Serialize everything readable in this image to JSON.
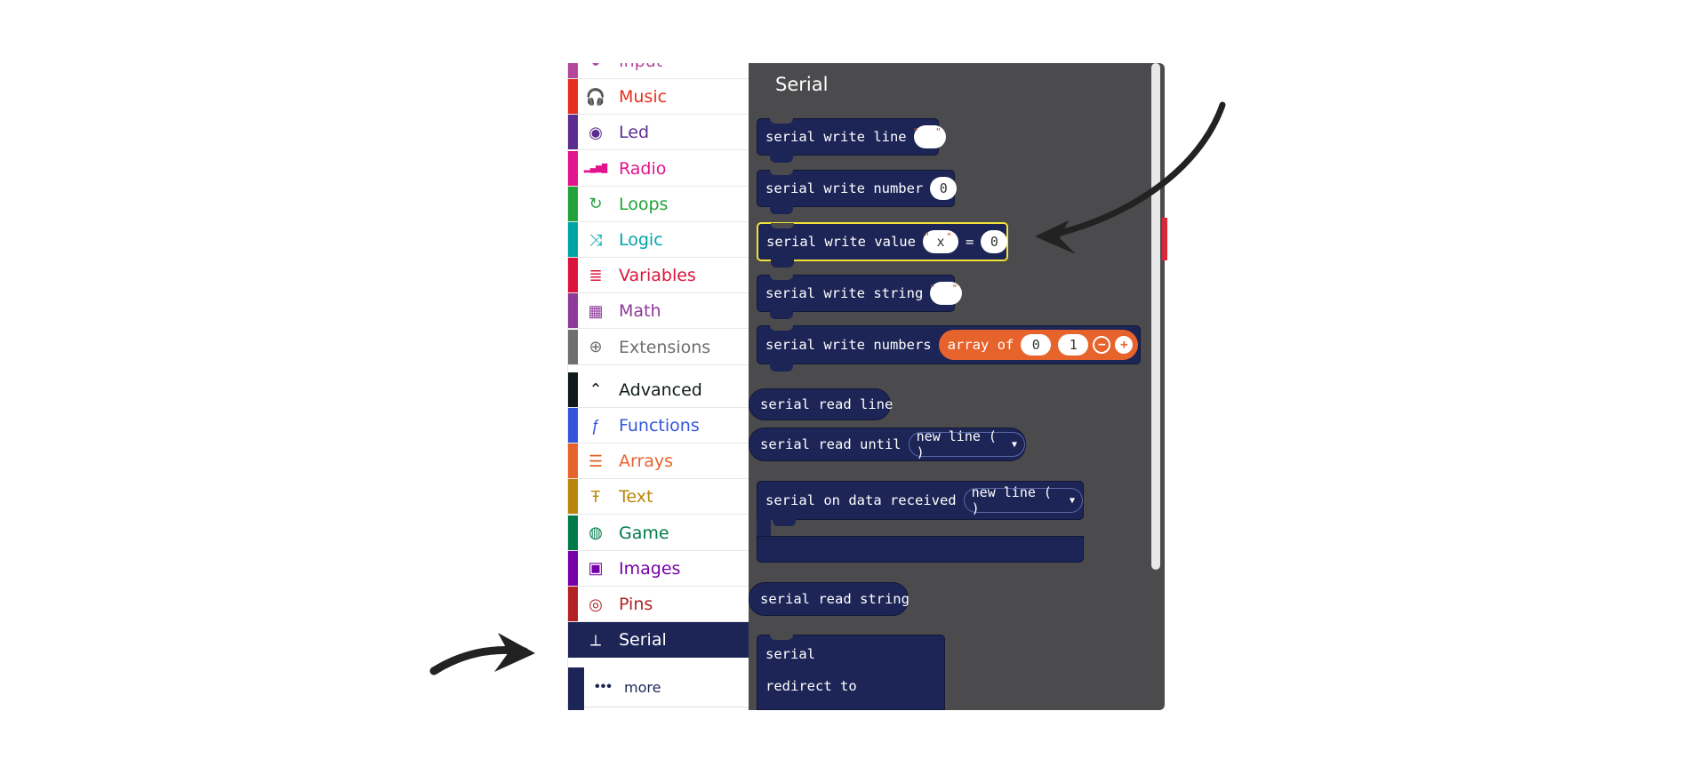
{
  "toolbox": {
    "items": [
      {
        "label": "Input",
        "color": "#b4479c",
        "icon": "input-icon"
      },
      {
        "label": "Music",
        "color": "#e52f1f",
        "icon": "headphones-icon"
      },
      {
        "label": "Led",
        "color": "#5c2d91",
        "icon": "toggle-icon"
      },
      {
        "label": "Radio",
        "color": "#e3138d",
        "icon": "signal-bars-icon"
      },
      {
        "label": "Loops",
        "color": "#21a339",
        "icon": "refresh-icon"
      },
      {
        "label": "Logic",
        "color": "#00a4a6",
        "icon": "shuffle-icon"
      },
      {
        "label": "Variables",
        "color": "#dc143c",
        "icon": "list-lines-icon"
      },
      {
        "label": "Math",
        "color": "#8e3a9a",
        "icon": "calculator-icon"
      },
      {
        "label": "Extensions",
        "color": "#6f6f6f",
        "icon": "plus-circle-icon"
      },
      {
        "label": "Advanced",
        "color": "#101a1a",
        "icon": "chevron-up-icon"
      },
      {
        "label": "Functions",
        "color": "#3455db",
        "icon": "function-icon"
      },
      {
        "label": "Arrays",
        "color": "#e7632c",
        "icon": "list-icon"
      },
      {
        "label": "Text",
        "color": "#b8860b",
        "icon": "text-icon"
      },
      {
        "label": "Game",
        "color": "#007a4b",
        "icon": "gamepad-icon"
      },
      {
        "label": "Images",
        "color": "#7600a8",
        "icon": "image-icon"
      },
      {
        "label": "Pins",
        "color": "#b22222",
        "icon": "target-icon"
      },
      {
        "label": "Serial",
        "color": "#1c2556",
        "icon": "usb-icon"
      }
    ],
    "more_label": "more",
    "more_dots": "•••"
  },
  "flyout": {
    "title": "Serial",
    "blocks": {
      "write_line": "serial write line",
      "write_number": "serial write number",
      "write_number_value": "0",
      "write_value": "serial write value",
      "write_value_name": "x",
      "write_value_eq": "=",
      "write_value_value": "0",
      "write_string": "serial write string",
      "write_numbers": "serial write numbers",
      "array_of": "array of",
      "array_val_0": "0",
      "array_val_1": "1",
      "read_line": "serial read line",
      "read_until": "serial read until",
      "read_until_option": "new line ( )",
      "on_data_received": "serial on data received",
      "on_data_option": "new line ( )",
      "read_string": "serial read string",
      "redirect_1": "serial",
      "redirect_2": "redirect to"
    }
  },
  "colors": {
    "flyout_bg": "#4b4a4c",
    "block_bg": "#1c2556",
    "highlight": "#f2e33a",
    "array_orange": "#e7632c"
  }
}
